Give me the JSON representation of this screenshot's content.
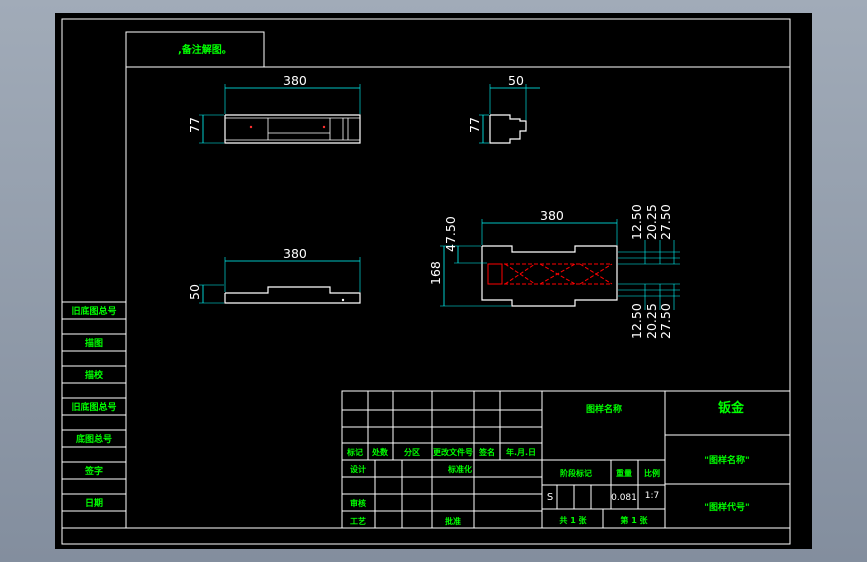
{
  "note": ",备注解图。",
  "views": {
    "front": {
      "width": "380",
      "height": "77"
    },
    "side": {
      "width": "50",
      "height": "77"
    },
    "top": {
      "width": "380",
      "height": "50"
    },
    "flat": {
      "width": "380",
      "height": "168",
      "left_top": "47.50",
      "right_top": [
        "12.50",
        "20.25",
        "27.50"
      ],
      "right_bottom": [
        "12.50",
        "20.25",
        "27.50"
      ]
    }
  },
  "side_table": [
    "旧底图总号",
    "描图",
    "描校",
    "旧底图总号",
    "底图总号",
    "签字",
    "日期"
  ],
  "title_block": {
    "drawing_title": "图样名称",
    "material": "钣金",
    "drawing_name": "\"图样名称\"",
    "drawing_code": "\"图样代号\"",
    "change_headers": [
      "标记",
      "处数",
      "分区",
      "更改文件号",
      "签名",
      "年.月.日"
    ],
    "role_labels": [
      "设计",
      "审核",
      "工艺"
    ],
    "standardization": "标准化",
    "approval": "批准",
    "stage_mark_label": "阶段标记",
    "weight_label": "重量",
    "scale_label": "比例",
    "stage": "S",
    "weight": "0.081",
    "scale": "1:7",
    "sheets_total": "共 1 张",
    "sheet_no": "第 1 张"
  },
  "colors": {
    "background": "#000000",
    "lines": "#ffffff",
    "dimensions": "#00ffff",
    "text": "#00ff00",
    "bend": "#ff0000"
  }
}
